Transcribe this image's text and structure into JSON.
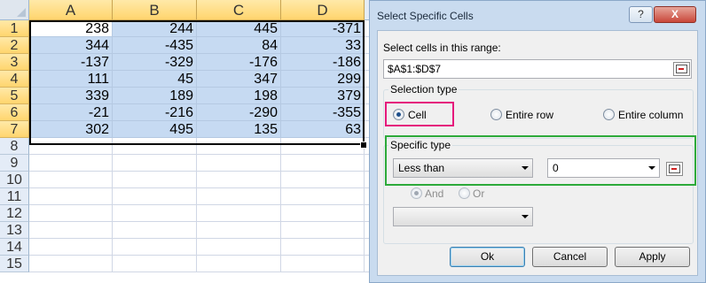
{
  "spreadsheet": {
    "columns": [
      "A",
      "B",
      "C",
      "D"
    ],
    "rows": [
      "1",
      "2",
      "3",
      "4",
      "5",
      "6",
      "7",
      "8",
      "9",
      "10",
      "11",
      "12",
      "13",
      "14",
      "15"
    ],
    "cells": [
      [
        "238",
        "244",
        "445",
        "-371"
      ],
      [
        "344",
        "-435",
        "84",
        "33"
      ],
      [
        "-137",
        "-329",
        "-176",
        "-186"
      ],
      [
        "111",
        "45",
        "347",
        "299"
      ],
      [
        "339",
        "189",
        "198",
        "379"
      ],
      [
        "-21",
        "-216",
        "-290",
        "-355"
      ],
      [
        "302",
        "495",
        "135",
        "63"
      ]
    ]
  },
  "dialog": {
    "title": "Select Specific Cells",
    "help_label": "?",
    "close_label": "X",
    "range_label": "Select cells in this range:",
    "range_value": "$A$1:$D$7",
    "selection_type": {
      "label": "Selection type",
      "options": [
        "Cell",
        "Entire row",
        "Entire column"
      ],
      "selected": "Cell"
    },
    "specific_type": {
      "label": "Specific type",
      "condition1": "Less than",
      "value1": "0",
      "and_label": "And",
      "or_label": "Or",
      "condition2": "",
      "logic_selected": "And"
    },
    "buttons": {
      "ok": "Ok",
      "cancel": "Cancel",
      "apply": "Apply"
    },
    "highlight_colors": {
      "selection_type": "#e5197c",
      "specific_type": "#2daa3a"
    }
  }
}
